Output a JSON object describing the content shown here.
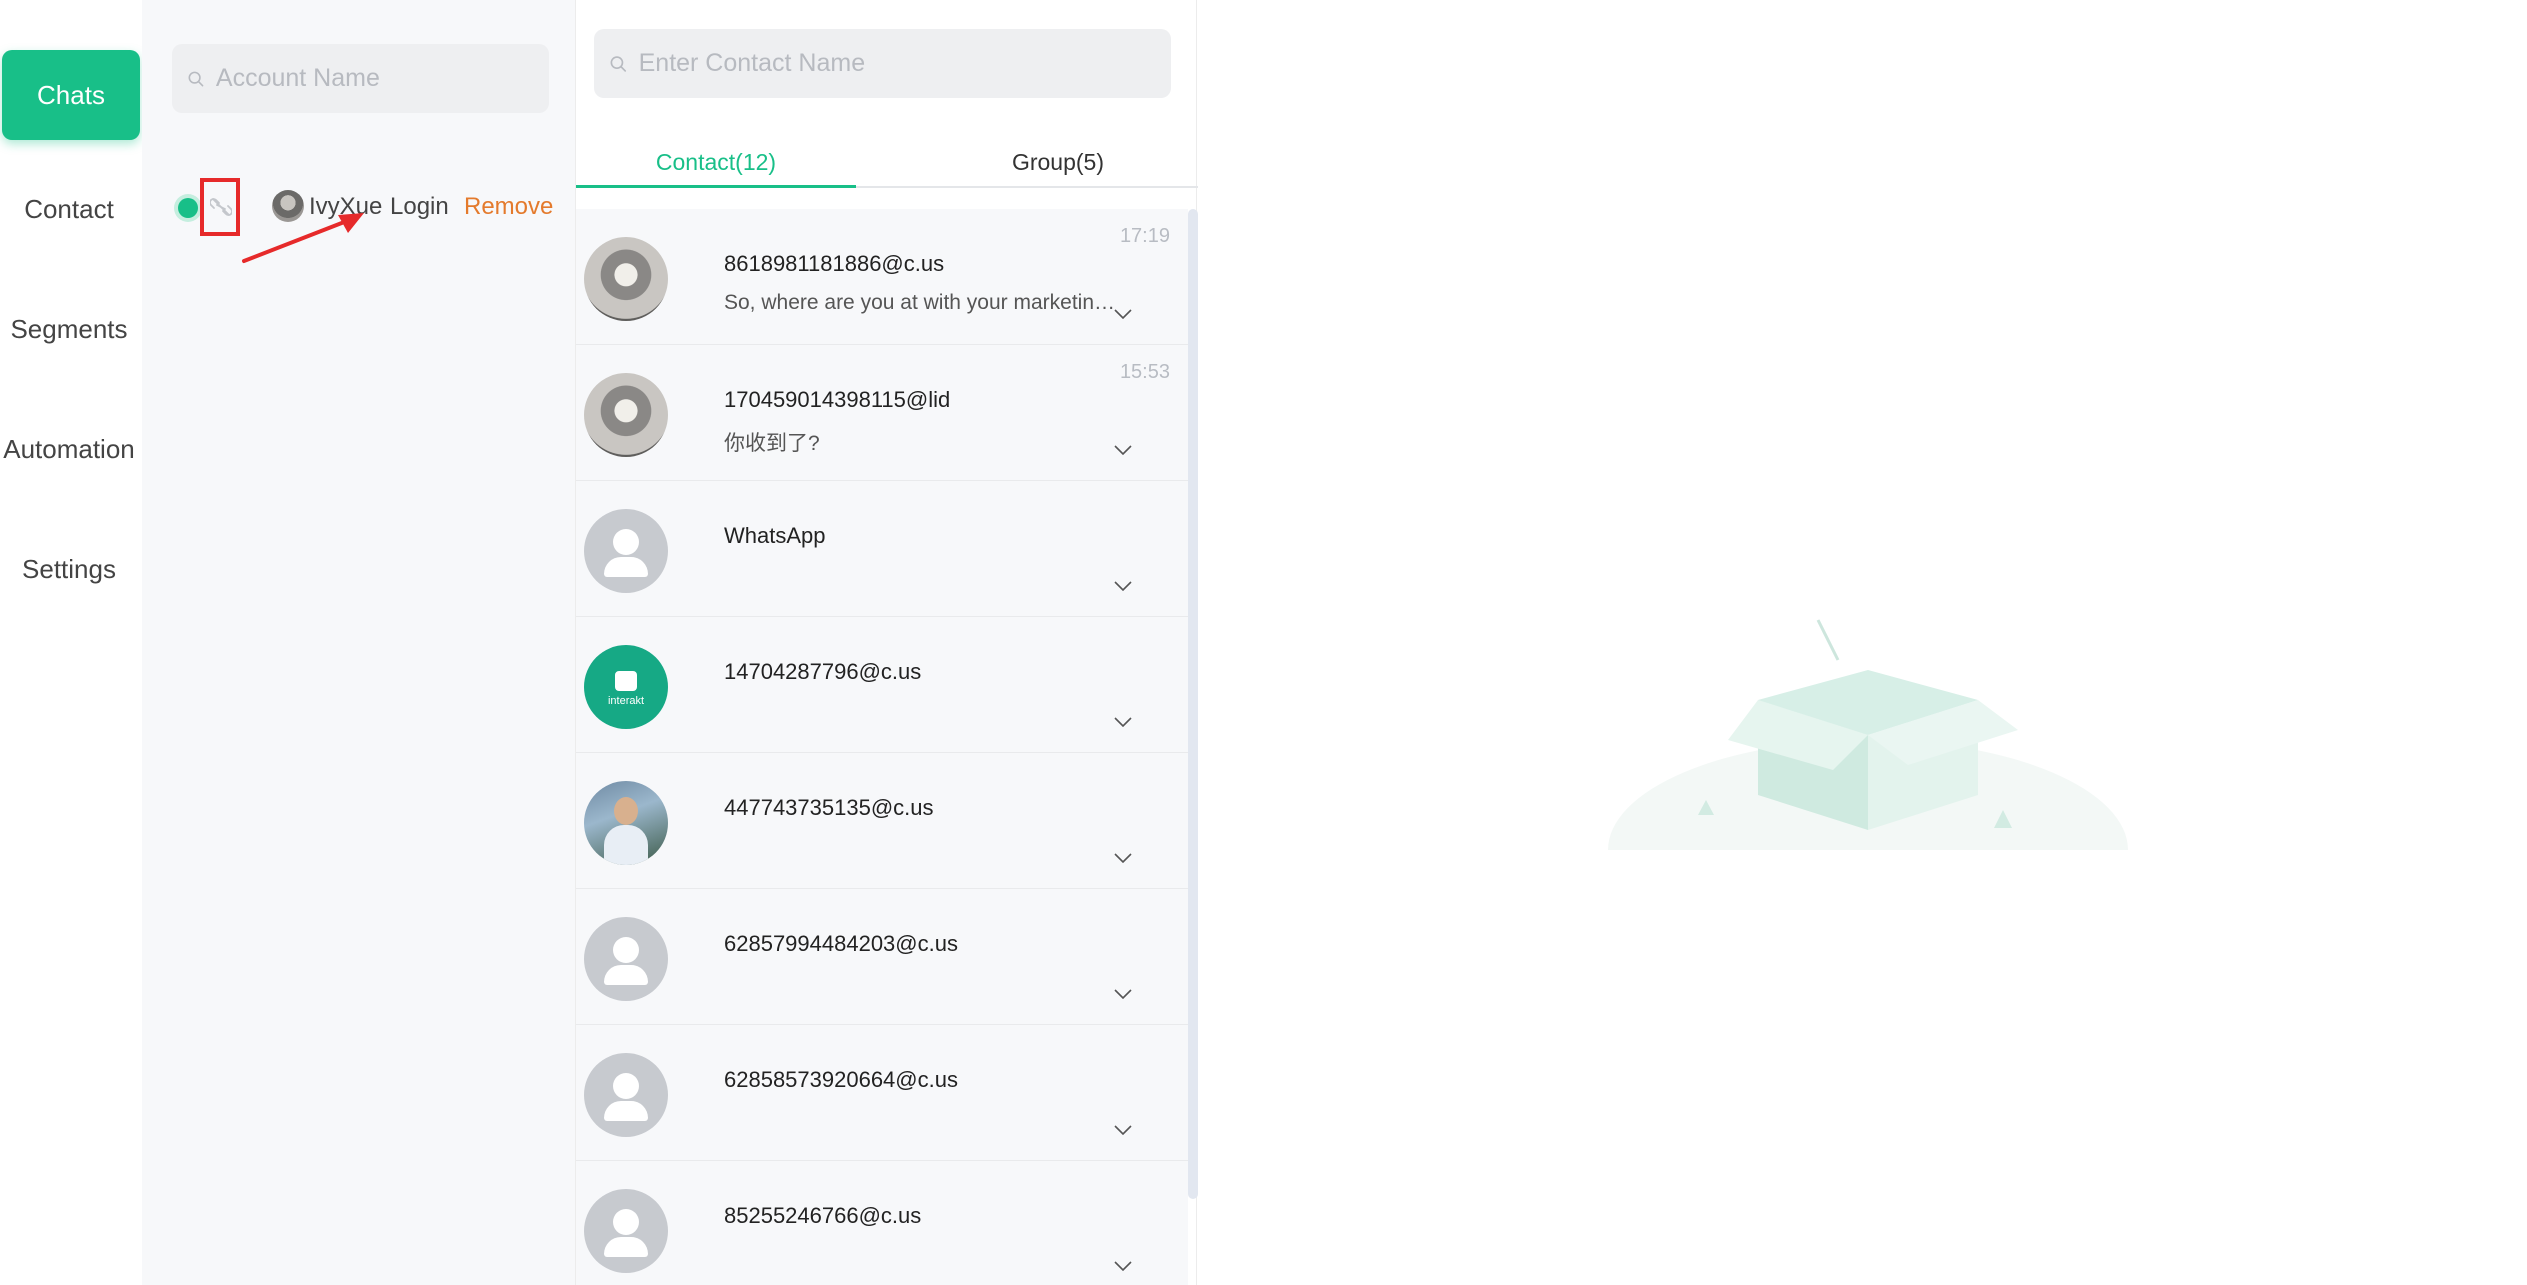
{
  "nav": {
    "items": [
      {
        "label": "Chats",
        "active": true
      },
      {
        "label": "Contact",
        "active": false
      },
      {
        "label": "Segments",
        "active": false
      },
      {
        "label": "Automation",
        "active": false
      },
      {
        "label": "Settings",
        "active": false
      }
    ]
  },
  "accounts": {
    "search_placeholder": "Account Name",
    "account": {
      "name": "IvyXue",
      "login_label": "Login",
      "remove_label": "Remove"
    }
  },
  "contacts": {
    "search_placeholder": "Enter Contact Name",
    "tabs": [
      {
        "label": "Contact(12)",
        "active": true
      },
      {
        "label": "Group(5)",
        "active": false
      }
    ],
    "rows": [
      {
        "name": "8618981181886@c.us",
        "preview": "So, where are you at with your marketing efforts?",
        "time": "17:19",
        "avatar": "photo"
      },
      {
        "name": "170459014398115@lid",
        "preview": "你收到了?",
        "time": "15:53",
        "avatar": "photo"
      },
      {
        "name": "WhatsApp",
        "preview": "",
        "time": "",
        "avatar": "default"
      },
      {
        "name": "14704287796@c.us",
        "preview": "",
        "time": "",
        "avatar": "brand",
        "brand_text": "interakt"
      },
      {
        "name": "447743735135@c.us",
        "preview": "",
        "time": "",
        "avatar": "photo2"
      },
      {
        "name": "62857994484203@c.us",
        "preview": "",
        "time": "",
        "avatar": "default"
      },
      {
        "name": "62858573920664@c.us",
        "preview": "",
        "time": "",
        "avatar": "default"
      },
      {
        "name": "85255246766@c.us",
        "preview": "",
        "time": "",
        "avatar": "default"
      }
    ]
  },
  "colors": {
    "accent": "#18bf88",
    "remove": "#e47a2c",
    "annotation": "#e62a2a"
  }
}
